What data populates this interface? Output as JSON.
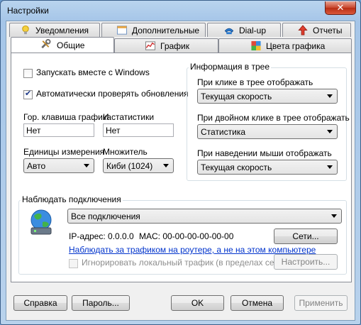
{
  "window": {
    "title": "Настройки",
    "close_glyph": "✕"
  },
  "tabs": {
    "notifications": "Уведомления",
    "additional": "Дополнительные",
    "dialup": "Dial-up",
    "reports": "Отчеты",
    "general": "Общие",
    "graph": "График",
    "graph_colors": "Цвета графика"
  },
  "general": {
    "start_with_windows": {
      "label": "Запускать вместе с Windows",
      "checked": false
    },
    "auto_check_updates": {
      "label": "Автоматически проверять обновления",
      "checked": true
    },
    "hotkey_label": "Гор. клавиша графика",
    "hotkey_value": "Нет",
    "stats_label": "И статистики",
    "stats_value": "Нет",
    "units_label": "Единицы измерения",
    "units_value": "Авто",
    "multiplier_label": "Множитель",
    "multiplier_value": "Киби (1024)"
  },
  "tray": {
    "group_title": "Информация в трее",
    "click_label": "При клике в трее отображать",
    "click_value": "Текущая скорость",
    "dblclick_label": "При двойном клике в трее отображать",
    "dblclick_value": "Статистика",
    "hover_label": "При наведении мыши отображать",
    "hover_value": "Текущая скорость"
  },
  "connections": {
    "group_title": "Наблюдать подключения",
    "selected": "Все подключения",
    "ip_text": "IP-адрес: 0.0.0.0",
    "mac_text": "MAC: 00-00-00-00-00-00",
    "networks_button": "Сети...",
    "router_link": "Наблюдать за трафиком на роутере, а не на этом компьютере",
    "ignore_local": {
      "label": "Игнорировать локальный трафик (в пределах сети",
      "checked": false
    },
    "configure_button": "Настроить..."
  },
  "footer": {
    "help": "Справка",
    "password": "Пароль...",
    "ok": "OK",
    "cancel": "Отмена",
    "apply": "Применить"
  }
}
